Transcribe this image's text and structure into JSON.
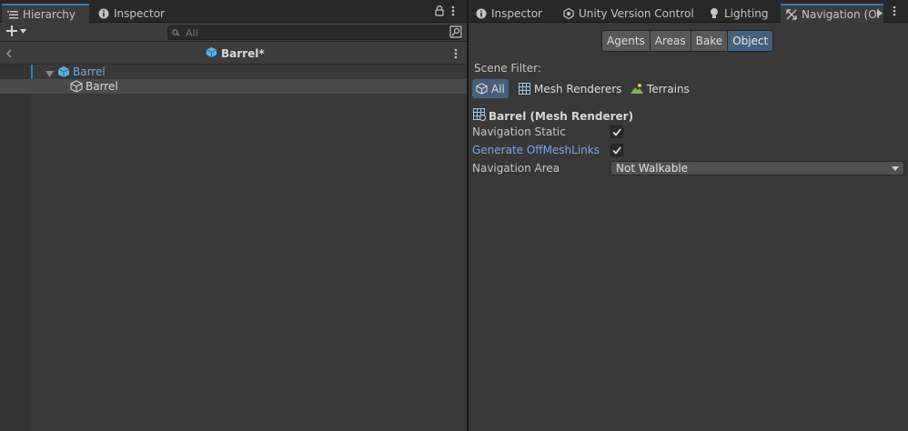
{
  "left": {
    "tabs": [
      {
        "label": "Hierarchy",
        "icon": "list-icon"
      },
      {
        "label": "Inspector",
        "icon": "info-icon"
      }
    ],
    "search_placeholder": "All",
    "scene_title": "Barrel*",
    "tree": [
      {
        "label": "Barrel",
        "level": 0,
        "expanded": true
      },
      {
        "label": "Barrel",
        "level": 1
      }
    ]
  },
  "right": {
    "tabs": [
      {
        "label": "Inspector",
        "icon": "info-icon"
      },
      {
        "label": "Unity Version Control",
        "icon": "version-control-icon"
      },
      {
        "label": "Lighting",
        "icon": "bulb-icon"
      },
      {
        "label": "Navigation (Ol",
        "icon": "navigation-icon"
      }
    ],
    "nav_tabs": [
      "Agents",
      "Areas",
      "Bake",
      "Object"
    ],
    "nav_active": "Object",
    "scene_filter_label": "Scene Filter:",
    "filters": [
      {
        "label": "All",
        "icon": "cube-icon",
        "active": true
      },
      {
        "label": "Mesh Renderers",
        "icon": "grid-icon",
        "active": false
      },
      {
        "label": "Terrains",
        "icon": "terrain-icon",
        "active": false
      }
    ],
    "object_title": "Barrel (Mesh Renderer)",
    "props": {
      "navigation_static": {
        "label": "Navigation Static",
        "checked": true
      },
      "generate_offmeshlinks": {
        "label": "Generate OffMeshLinks",
        "checked": true
      },
      "navigation_area": {
        "label": "Navigation Area",
        "value": "Not Walkable"
      }
    },
    "colors": {
      "accent": "#46607c",
      "link_blue": "#7ba4e6"
    }
  }
}
